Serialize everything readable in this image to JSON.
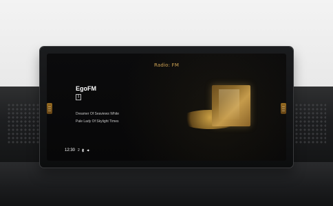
{
  "screen": {
    "title": "Radio: FM",
    "time": "12:30",
    "station_name": "EgoFM",
    "preset_label": "1",
    "track_title": "Dreamer Of Seaviews White",
    "track_artist": "Pale Lady Of Skylight Times",
    "status_text": "2",
    "icons": {
      "left_tab": "left-tab-icon",
      "right_tab": "right-tab-icon",
      "phone": "phone-icon",
      "bluetooth": "bluetooth-icon",
      "volume": "volume-icon"
    }
  }
}
